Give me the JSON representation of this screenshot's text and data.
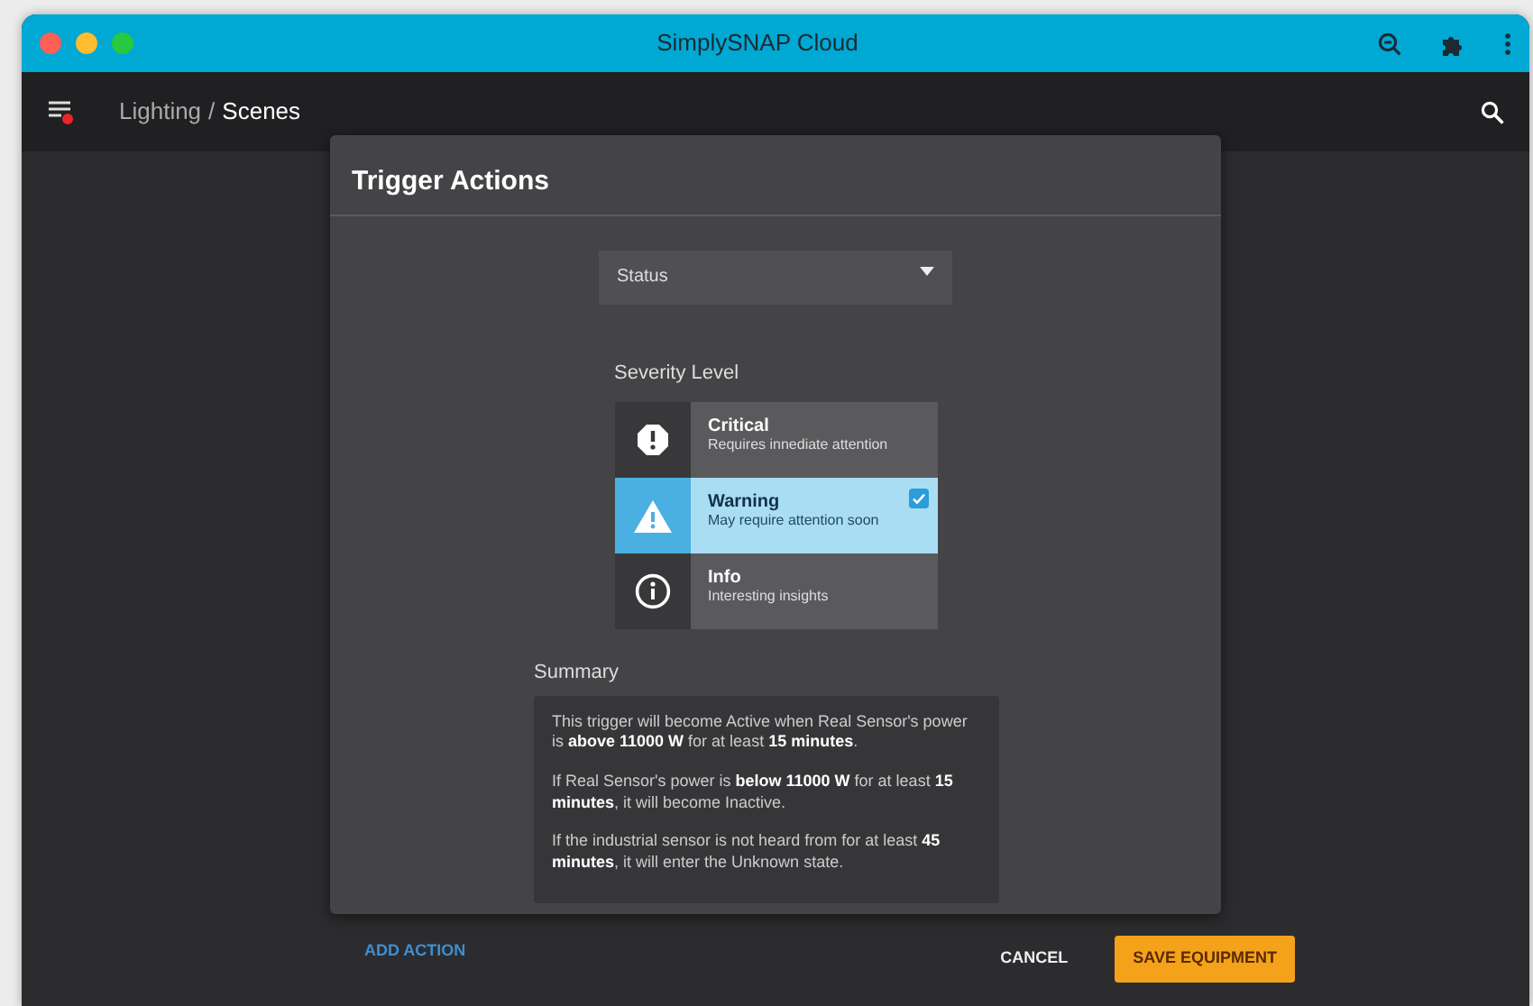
{
  "window": {
    "title": "SimplySNAP Cloud"
  },
  "app_bar": {
    "breadcrumb": [
      {
        "label": "Lighting",
        "current": false
      },
      {
        "label": "Scenes",
        "current": true
      }
    ],
    "separator": "/"
  },
  "dialog": {
    "title": "Trigger Actions",
    "select": {
      "value": "Status"
    },
    "severity": {
      "label": "Severity Level",
      "options": [
        {
          "kind": "critical",
          "title": "Critical",
          "subtitle": "Requires innediate attention",
          "selected": false
        },
        {
          "kind": "warning",
          "title": "Warning",
          "subtitle": "May require attention soon",
          "selected": true
        },
        {
          "kind": "info",
          "title": "Info",
          "subtitle": "Interesting insights",
          "selected": false
        }
      ]
    },
    "summary": {
      "label": "Summary",
      "paragraphs": [
        "This trigger will become Active when Real Sensor's power is **above 11000 W** for at least **15 minutes**.",
        "If Real Sensor's power is **below 11000 W** for at least **15 minutes**, it will become Inactive.",
        "If the industrial sensor is not heard from for at least **45 minutes**, it will enter the Unknown state."
      ]
    },
    "add_action": "ADD ACTION"
  },
  "footer_buttons": [
    {
      "label": "CANCEL",
      "kind": "text"
    },
    {
      "label": "SAVE EQUIPMENT",
      "kind": "primary"
    }
  ]
}
